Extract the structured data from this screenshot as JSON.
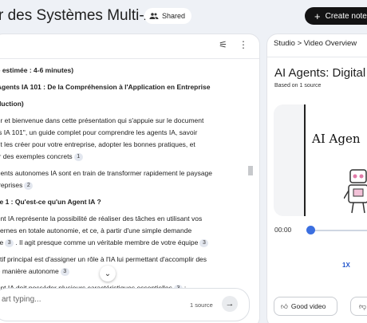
{
  "header": {
    "notebook_title": "r des Systèmes Multi-Agents",
    "shared_label": "Shared",
    "create_label": "Create notebo"
  },
  "chat": {
    "lines": [
      {
        "text": "ée estimée : 4-6 minutes)",
        "bold": true
      },
      {
        "text": ": Agents IA 101 : De la Compréhension à l'Application en Entreprise",
        "bold": true
      },
      {
        "text": "oduction)",
        "bold": true
      },
      {
        "text": "our et bienvenue dans cette présentation qui s'appuie sur le document"
      },
      {
        "text": "nts IA 101\", un guide complet pour comprendre les agents IA, savoir"
      },
      {
        "text": "ent les créer pour votre entreprise, adopter les bonnes pratiques, et"
      },
      {
        "text": "rer des exemples concrets",
        "cite": "1"
      },
      {
        "text": "agents autonomes IA sont en train de transformer rapidement le paysage"
      },
      {
        "text": "ntreprises",
        "cite": "2"
      },
      {
        "text": "itre 1 : Qu'est-ce qu'un Agent IA ?",
        "bold": true
      },
      {
        "text": "gent IA représente la possibilité de réaliser des tâches en utilisant vos"
      },
      {
        "text": "internes en totale autonomie, et ce, à partir d'une simple demande"
      },
      {
        "text": "elle",
        "cite": "3",
        "tail": ". Il agit presque comme un véritable membre de votre équipe",
        "cite2": "3"
      },
      {
        "text": "ectif principal est d'assigner un rôle à l'IA lui permettant d'accomplir des"
      },
      {
        "text": "de manière autonome",
        "cite": "3"
      },
      {
        "text": "gent IA doit posséder plusieurs caractéristiques essentielles",
        "cite": "3",
        "tail": ":"
      }
    ],
    "input_placeholder": "art typing...",
    "source_count": "1 source"
  },
  "studio": {
    "breadcrumb": "Studio > Video Overview",
    "video_title": "AI Agents: Digital W",
    "video_subtitle": "Based on 1 source",
    "thumbnail_text": "AI Agen",
    "time": "00:00",
    "progress": 0,
    "speed": "1X",
    "good_label": "Good video"
  }
}
